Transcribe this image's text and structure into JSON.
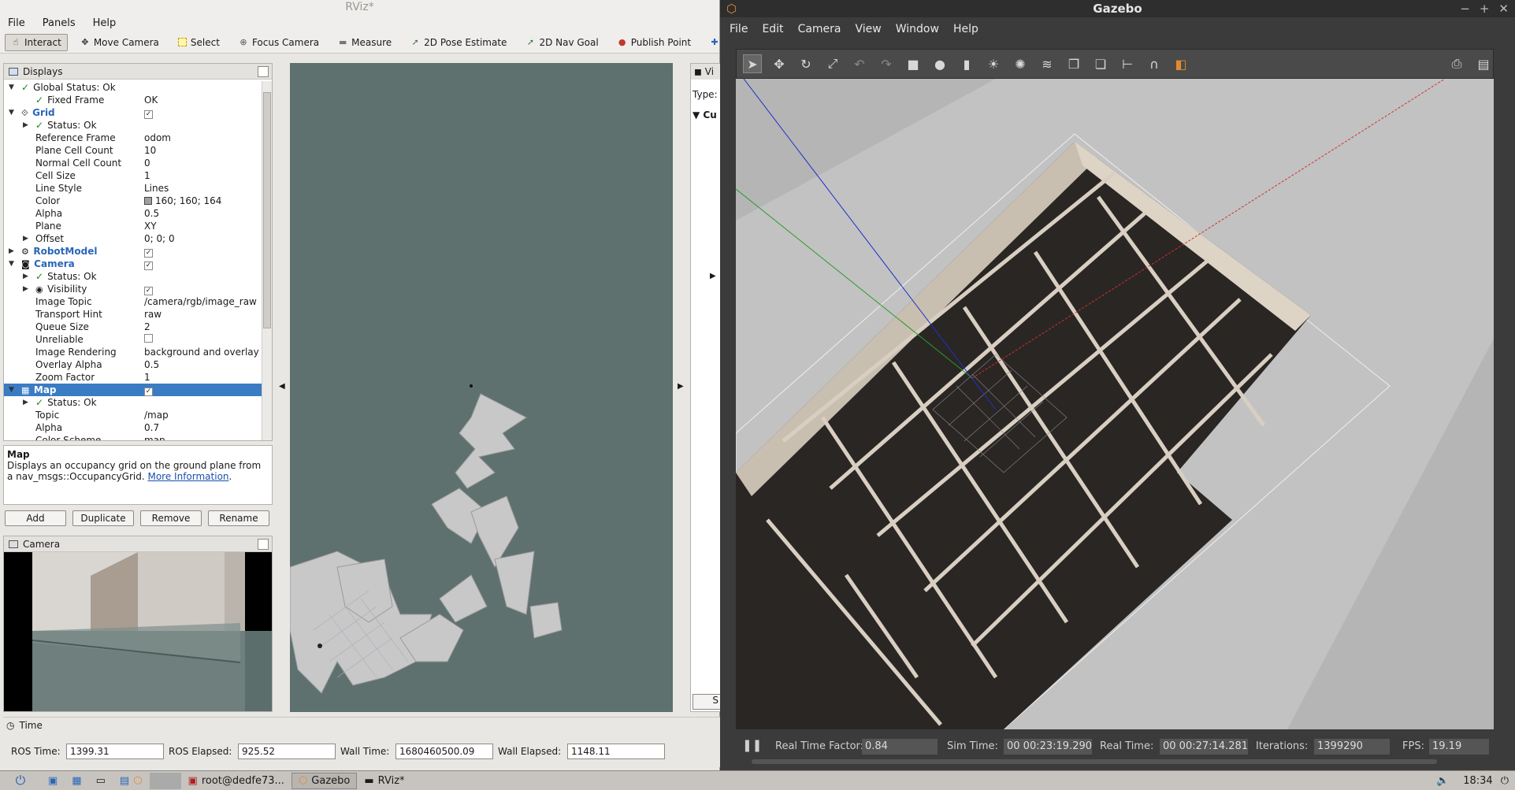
{
  "rviz": {
    "title": "RViz*",
    "menu": [
      "File",
      "Panels",
      "Help"
    ],
    "tools": [
      {
        "label": "Interact",
        "icon": "hand-icon"
      },
      {
        "label": "Move Camera",
        "icon": "move-icon"
      },
      {
        "label": "Select",
        "icon": "select-icon"
      },
      {
        "label": "Focus Camera",
        "icon": "focus-icon"
      },
      {
        "label": "Measure",
        "icon": "ruler-icon"
      },
      {
        "label": "2D Pose Estimate",
        "icon": "arrow-icon"
      },
      {
        "label": "2D Nav Goal",
        "icon": "arrow-icon"
      },
      {
        "label": "Publish Point",
        "icon": "pin-icon"
      }
    ],
    "displays": {
      "title": "Displays",
      "rows": [
        {
          "name": "Global Status: Ok",
          "value": ""
        },
        {
          "name": "Fixed Frame",
          "value": "OK"
        },
        {
          "name": "Grid",
          "value": ""
        },
        {
          "name": "Status: Ok",
          "value": ""
        },
        {
          "name": "Reference Frame",
          "value": "odom"
        },
        {
          "name": "Plane Cell Count",
          "value": "10"
        },
        {
          "name": "Normal Cell Count",
          "value": "0"
        },
        {
          "name": "Cell Size",
          "value": "1"
        },
        {
          "name": "Line Style",
          "value": "Lines"
        },
        {
          "name": "Color",
          "value": "160; 160; 164"
        },
        {
          "name": "Alpha",
          "value": "0.5"
        },
        {
          "name": "Plane",
          "value": "XY"
        },
        {
          "name": "Offset",
          "value": "0; 0; 0"
        },
        {
          "name": "RobotModel",
          "value": ""
        },
        {
          "name": "Camera",
          "value": ""
        },
        {
          "name": "Status: Ok",
          "value": ""
        },
        {
          "name": "Visibility",
          "value": ""
        },
        {
          "name": "Image Topic",
          "value": "/camera/rgb/image_raw"
        },
        {
          "name": "Transport Hint",
          "value": "raw"
        },
        {
          "name": "Queue Size",
          "value": "2"
        },
        {
          "name": "Unreliable",
          "value": ""
        },
        {
          "name": "Image Rendering",
          "value": "background and overlay"
        },
        {
          "name": "Overlay Alpha",
          "value": "0.5"
        },
        {
          "name": "Zoom Factor",
          "value": "1"
        },
        {
          "name": "Map",
          "value": ""
        },
        {
          "name": "Status: Ok",
          "value": ""
        },
        {
          "name": "Topic",
          "value": "/map"
        },
        {
          "name": "Alpha",
          "value": "0.7"
        },
        {
          "name": "Color Scheme",
          "value": "map"
        }
      ]
    },
    "description": {
      "title": "Map",
      "text": "Displays an occupancy grid on the ground plane from a nav_msgs::OccupancyGrid.",
      "link": "More Information"
    },
    "buttons": {
      "add": "Add",
      "duplicate": "Duplicate",
      "remove": "Remove",
      "rename": "Rename"
    },
    "camera_panel": {
      "title": "Camera"
    },
    "views_panel": {
      "title": "Vi",
      "type_label": "Type:",
      "item": "Cu",
      "button": "S"
    },
    "time": {
      "title": "Time",
      "ros_time_label": "ROS Time:",
      "ros_time": "1399.31",
      "ros_elapsed_label": "ROS Elapsed:",
      "ros_elapsed": "925.52",
      "wall_time_label": "Wall Time:",
      "wall_time": "1680460500.09",
      "wall_elapsed_label": "Wall Elapsed:",
      "wall_elapsed": "1148.11"
    }
  },
  "gazebo": {
    "title": "Gazebo",
    "menu": [
      "File",
      "Edit",
      "Camera",
      "View",
      "Window",
      "Help"
    ],
    "bottom": {
      "rtf_label": "Real Time Factor:",
      "rtf": "0.84",
      "sim_label": "Sim Time:",
      "sim": "00 00:23:19.290",
      "real_label": "Real Time:",
      "real": "00 00:27:14.281",
      "iter_label": "Iterations:",
      "iter": "1399290",
      "fps_label": "FPS:",
      "fps": "19.19"
    }
  },
  "taskbar": {
    "tasks": [
      "root@dedfe73...",
      "Gazebo",
      "RViz*"
    ],
    "clock": "18:34"
  },
  "colors": {
    "rviz_bg": "#5e716e",
    "selection": "#3a7cc4",
    "gazebo_bg": "#3b3b3b",
    "ok_green": "#188a18"
  }
}
